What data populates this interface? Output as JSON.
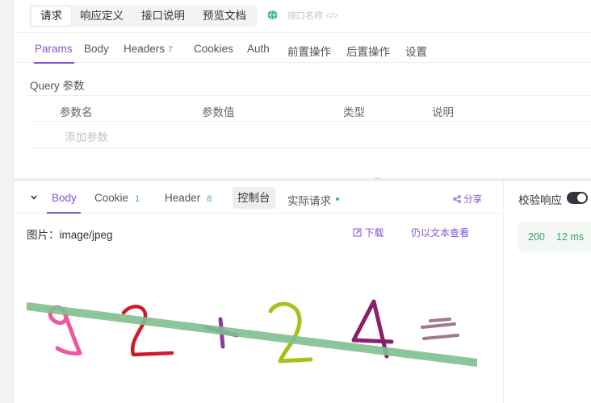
{
  "top_tabs": [
    "请求",
    "响应定义",
    "接口说明",
    "预览文档"
  ],
  "api_name_placeholder": "接口名称",
  "api_name_icon": "code-icon",
  "request_tabs": {
    "params": "Params",
    "body": "Body",
    "headers": "Headers",
    "headers_count": "7",
    "cookies": "Cookies",
    "auth": "Auth",
    "pre": "前置操作",
    "post": "后置操作",
    "settings": "设置"
  },
  "query": {
    "title": "Query 参数",
    "columns": [
      "参数名",
      "参数值",
      "类型",
      "说明"
    ],
    "add_placeholder": "添加参数"
  },
  "splitter_handle": "···",
  "response_tabs": {
    "body": "Body",
    "cookie": "Cookie",
    "cookie_count": "1",
    "header": "Header",
    "header_count": "8",
    "console": "控制台",
    "actual_request": "实际请求",
    "share": "分享"
  },
  "response": {
    "mime_label": "图片：image/jpeg",
    "download": "下载",
    "view_as_text": "仍以文本查看"
  },
  "validate_response": "校验响应",
  "status_code": "200",
  "response_time": "12 ms",
  "colors": {
    "accent": "#8256d0",
    "success": "#45b27a",
    "toggle": "#35353d"
  }
}
